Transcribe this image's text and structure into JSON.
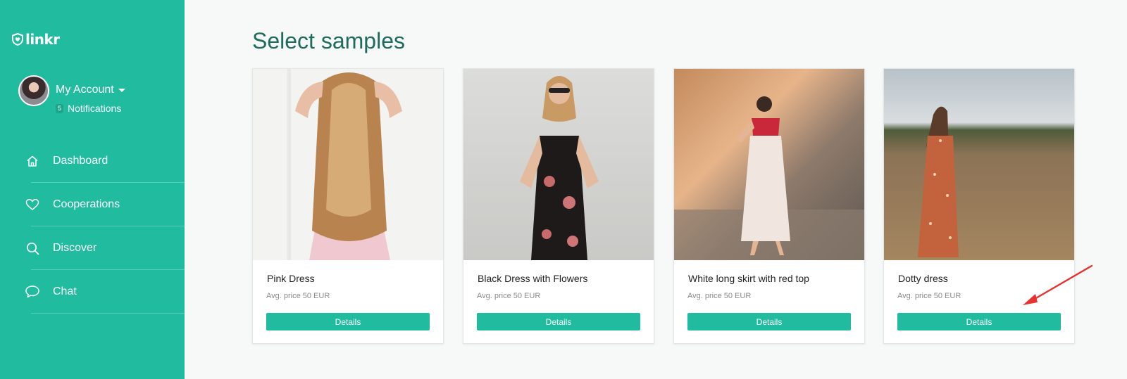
{
  "brand": {
    "name": "linkr",
    "color": "#21bc9f"
  },
  "account": {
    "name": "My Account",
    "notification_count": "5",
    "notification_label": "Notifications"
  },
  "nav": [
    {
      "label": "Dashboard",
      "icon": "home-icon"
    },
    {
      "label": "Cooperations",
      "icon": "heart-icon"
    },
    {
      "label": "Discover",
      "icon": "search-icon"
    },
    {
      "label": "Chat",
      "icon": "chat-bubble-icon"
    }
  ],
  "page": {
    "title": "Select samples"
  },
  "samples": [
    {
      "title": "Pink Dress",
      "price": "Avg. price 50 EUR",
      "button": "Details"
    },
    {
      "title": "Black Dress with Flowers",
      "price": "Avg. price 50 EUR",
      "button": "Details"
    },
    {
      "title": "White long skirt with red top",
      "price": "Avg. price 50 EUR",
      "button": "Details"
    },
    {
      "title": "Dotty dress",
      "price": "Avg. price 50 EUR",
      "button": "Details"
    }
  ],
  "annotation": {
    "type": "red-arrow",
    "color": "#e8322f",
    "target": "Dotty dress Details button"
  }
}
